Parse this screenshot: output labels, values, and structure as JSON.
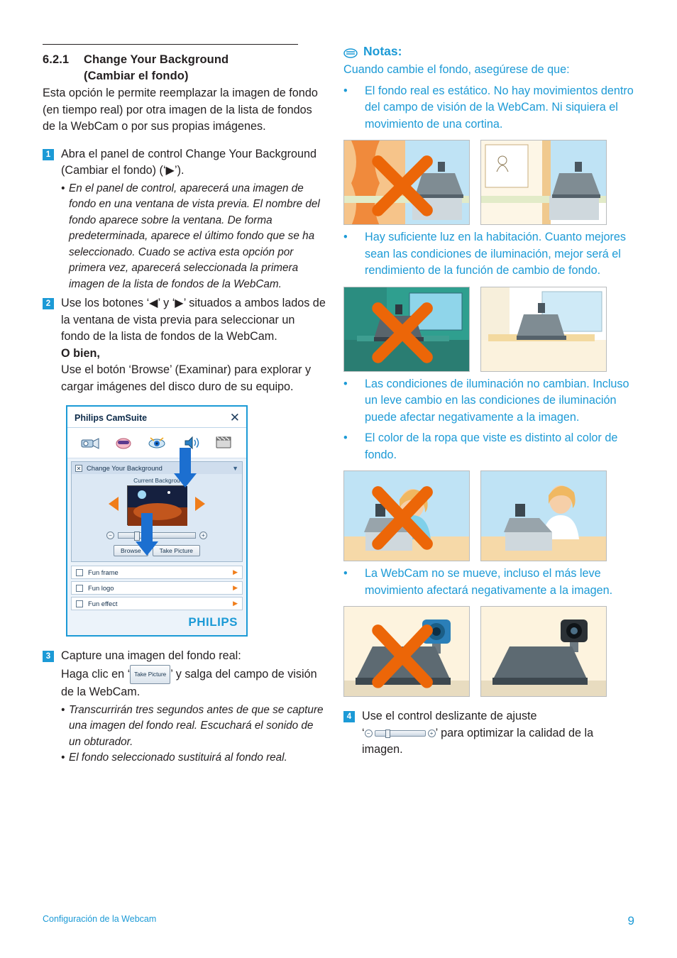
{
  "left": {
    "section_number": "6.2.1",
    "section_title_line1": "Change Your Background",
    "section_title_line2": "(Cambiar el fondo)",
    "intro": "Esta opción le permite reemplazar la imagen de fondo (en tiempo real) por otra imagen de la lista de fondos de la WebCam o por sus propias imágenes.",
    "steps": [
      {
        "num": "1",
        "text": "Abra el panel de control Change Your Background (Cambiar el fondo) (‘▶’).",
        "bullets": [
          "En el panel de control, aparecerá una imagen de fondo en una ventana de vista previa. El nombre del fondo aparece sobre la ventana. De forma predeterminada, aparece el último fondo que se ha seleccionado. Cuado se activa esta opción por primera vez, aparecerá seleccionada la primera imagen de la lista de fondos de la WebCam."
        ]
      },
      {
        "num": "2",
        "text": "Use los botones ‘◀’ y ‘▶’ situados a ambos lados de la ventana de vista previa para seleccionar un fondo de la lista de fondos de la WebCam.",
        "bold_line": "O bien,",
        "text2": "Use el botón ‘Browse’ (Examinar) para explorar y cargar imágenes del disco duro de su equipo."
      },
      {
        "num": "3",
        "text_a": "Capture una imagen del fondo real:",
        "text_b_pre": "Haga clic en ‘",
        "inline_button": "Take Picture",
        "text_b_post": "’ y salga del campo de visión de la WebCam.",
        "bullets": [
          "Transcurrirán tres segundos antes de que se capture una imagen del fondo real. Escuchará el sonido de un obturador.",
          "El fondo seleccionado sustituirá al fondo real."
        ]
      }
    ]
  },
  "camsuite": {
    "title": "Philips CamSuite",
    "close": "✕",
    "panel_label": "Change Your Background",
    "checkbox_mark": "✕",
    "caption": "Current Backgrou",
    "browse_button": "Browse",
    "take_picture_button": "Take Picture",
    "minus": "−",
    "plus": "+",
    "rows": [
      {
        "label": "Fun frame"
      },
      {
        "label": "Fun logo"
      },
      {
        "label": "Fun effect"
      }
    ],
    "brand": "PHILIPS"
  },
  "right": {
    "notes_title": "Notas:",
    "notes_intro": "Cuando cambie el fondo, asegúrese de que:",
    "bullets": [
      "El fondo real es estático. No hay movimientos dentro del campo de visión de la WebCam. Ni siquiera el movimiento de una cortina.",
      "Hay suficiente luz en la habitación. Cuanto mejores sean las condiciones de iluminación, mejor será el rendimiento de la función de cambio de fondo.",
      "Las condiciones de iluminación no cambian. Incluso un leve cambio en las condiciones de iluminación puede afectar negativamente a la imagen.",
      "El color de la ropa que viste es distinto al color de fondo.",
      "La WebCam no se mueve, incluso el más leve movimiento afectará negativamente a la imagen."
    ],
    "step4": {
      "num": "4",
      "text_a": "Use el control deslizante de ajuste",
      "text_b_pre": "‘",
      "text_b_post": "’ para optimizar la calidad de la imagen."
    }
  },
  "footer": {
    "left": "Configuración de la Webcam",
    "page": "9"
  },
  "colors": {
    "blue": "#1c9ad6",
    "orange": "#ec6608",
    "text": "#231f20"
  }
}
